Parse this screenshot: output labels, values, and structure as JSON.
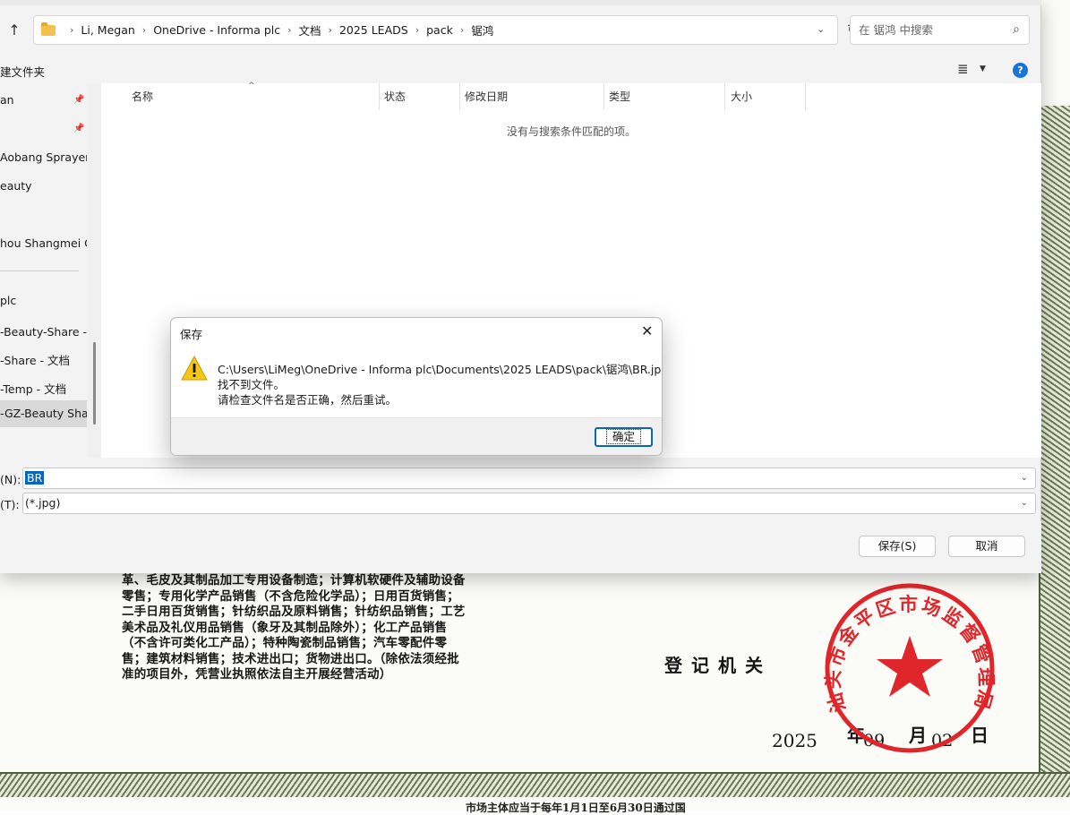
{
  "background_document": {
    "scope_text": "革、毛皮及其制品加工专用设备制造；计算机软硬件及辅助设备\n零售；专用化学产品销售（不含危险化学品）；日用百货销售；\n二手日用百货销售；针纺织品及原料销售；针纺织品销售；工艺\n美术品及礼仪用品销售（象牙及其制品除外）；化工产品销售\n（不含许可类化工产品）；特种陶瓷制品销售；汽车零配件零\n售；建筑材料销售；技术进出口；货物进出口。（除依法须经批\n准的项目外，凭营业执照依法自主开展经营活动）",
    "authority_label": "登记机关",
    "date_year": "2025",
    "date_year_suffix": "年",
    "date_month": "09",
    "date_month_suffix": "月",
    "date_day": "02",
    "date_day_suffix": "日",
    "seal_text": "汕头市金平区市场监督管理局",
    "bottom_note": "市场主体应当于每年1月1日至6月30日通过国"
  },
  "file_dialog": {
    "breadcrumbs": [
      "Li, Megan",
      "OneDrive - Informa plc",
      "文档",
      "2025 LEADS",
      "pack",
      "锯鸿"
    ],
    "search_placeholder": "在 锯鸿 中搜索",
    "new_folder_label": "建文件夹",
    "nav_items": [
      {
        "label": "an",
        "pinned": true
      },
      {
        "label": "",
        "pinned": true
      },
      {
        "label": "Aobang Sprayer",
        "pinned": false
      },
      {
        "label": "eauty",
        "pinned": false
      },
      {
        "label": "hou Shangmei Co",
        "pinned": false
      },
      {
        "label": " plc",
        "pinned": false
      },
      {
        "label": "-Beauty-Share - 文",
        "pinned": false
      },
      {
        "label": "-Share - 文档",
        "pinned": false
      },
      {
        "label": "-Temp - 文档",
        "pinned": false
      },
      {
        "label": "-GZ-Beauty Shar",
        "pinned": false,
        "selected": true
      }
    ],
    "columns": [
      "名称",
      "状态",
      "修改日期",
      "类型",
      "大小"
    ],
    "empty_message": "没有与搜索条件匹配的项。",
    "filename_label": "(N):",
    "filename_value": "BR",
    "filetype_label": "(T):",
    "filetype_value": "(*.jpg)",
    "save_button": "保存(S)",
    "cancel_button": "取消"
  },
  "message_box": {
    "title": "保存",
    "path": "C:\\Users\\LiMeg\\OneDrive - Informa plc\\Documents\\2025 LEADS\\pack\\锯鸿\\BR.jpg",
    "line2": "找不到文件。",
    "line3": "请检查文件名是否正确，然后重试。",
    "ok_button": "确定"
  },
  "colors": {
    "accent": "#0a64c2",
    "warning": "#f5c518",
    "seal_red": "#e0262b"
  }
}
